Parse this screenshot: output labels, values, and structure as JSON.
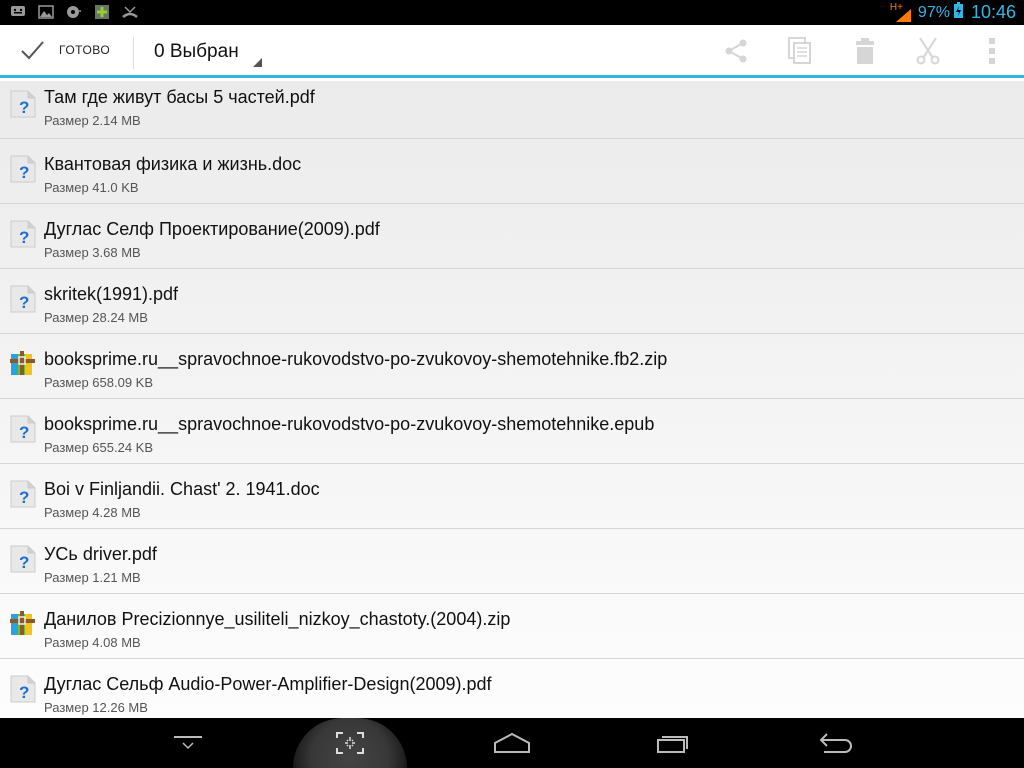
{
  "status_bar": {
    "network": "H+",
    "battery": "97%",
    "time": "10:46",
    "left_icons": [
      "chat-icon",
      "image-icon",
      "media-icon",
      "android-market-icon",
      "missed-call-icon"
    ]
  },
  "action_bar": {
    "done_label": "ГОТОВО",
    "selected_label": "0 Выбран",
    "actions": [
      "share-icon",
      "copy-icon",
      "delete-icon",
      "cut-icon",
      "overflow-menu-icon"
    ]
  },
  "files": [
    {
      "name": "Там где живут басы 5 частей.pdf",
      "size": "Размер 2.14 MB",
      "icon": "unknown"
    },
    {
      "name": "Квантовая физика и жизнь.doc",
      "size": "Размер 41.0 KB",
      "icon": "unknown"
    },
    {
      "name": "Дуглас Селф Проектирование(2009).pdf",
      "size": "Размер 3.68 MB",
      "icon": "unknown"
    },
    {
      "name": "skritek(1991).pdf",
      "size": "Размер 28.24 MB",
      "icon": "unknown"
    },
    {
      "name": "booksprime.ru__spravochnoe-rukovodstvo-po-zvukovoy-shemotehnike.fb2.zip",
      "size": "Размер 658.09 KB",
      "icon": "archive"
    },
    {
      "name": "booksprime.ru__spravochnoe-rukovodstvo-po-zvukovoy-shemotehnike.epub",
      "size": "Размер 655.24 KB",
      "icon": "unknown"
    },
    {
      "name": "Boi v Finljandii. Chast' 2. 1941.doc",
      "size": "Размер 4.28 MB",
      "icon": "unknown"
    },
    {
      "name": "УСь driver.pdf",
      "size": "Размер 1.21 MB",
      "icon": "unknown"
    },
    {
      "name": "Данилов Precizionnye_usiliteli_nizkoy_chastoty.(2004).zip",
      "size": "Размер 4.08 MB",
      "icon": "archive"
    },
    {
      "name": "Дуглас Сельф Audio-Power-Amplifier-Design(2009).pdf",
      "size": "Размер 12.26 MB",
      "icon": "unknown"
    }
  ],
  "colors": {
    "accent": "#33b5e5",
    "signal": "#ff7a00"
  }
}
